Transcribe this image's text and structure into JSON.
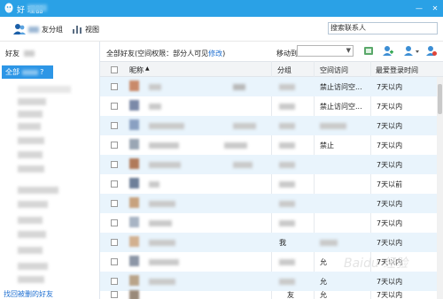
{
  "titlebar": {
    "title": "好    理器",
    "minimize": "—",
    "close": "✕"
  },
  "toolbar": {
    "friend_group_label": "友分组",
    "view_label": "视图",
    "search_placeholder": "搜索联系人"
  },
  "sidebar": {
    "header": "好友",
    "all_item": "全部",
    "all_suffix": "?",
    "restore_link": "找回被删的好友"
  },
  "main": {
    "permission_text": "全部好友(空间权限：部分人可见",
    "permission_link": "修改",
    "permission_close": ")",
    "move_to_label": "移动到"
  },
  "table": {
    "columns": [
      "昵称",
      "分组",
      "空间访问",
      "最爱登录时间"
    ],
    "rows": [
      {
        "access": "禁止访问空...",
        "login": "7天以内"
      },
      {
        "access": "禁止访问空...",
        "login": "7天以内"
      },
      {
        "access": "",
        "login": "7天以内"
      },
      {
        "access": "",
        "login": "7天以内"
      },
      {
        "access": "",
        "login": "7天以内"
      },
      {
        "access": "",
        "login": "7天以前"
      },
      {
        "access": "",
        "login": "7天以内"
      },
      {
        "access": "",
        "login": "7天以内"
      },
      {
        "access": "",
        "login": "7天以内"
      },
      {
        "access": "",
        "login": "7天以内"
      },
      {
        "access": "",
        "login": "7天以内"
      },
      {
        "access": "",
        "login": "7天以内"
      }
    ],
    "row_fragments": {
      "r4_access": "禁止",
      "r9_group": "我",
      "r10_access": "允",
      "r10_login": "7天以内",
      "r11_access": "允",
      "r12_group": "友",
      "r12_access": "允"
    }
  },
  "watermark": "Baidu 经验",
  "colors": {
    "titlebar": "#2aa1e6",
    "selected": "#2d96e6",
    "alt_row": "#e9f4fc",
    "link": "#1e6fd1"
  }
}
